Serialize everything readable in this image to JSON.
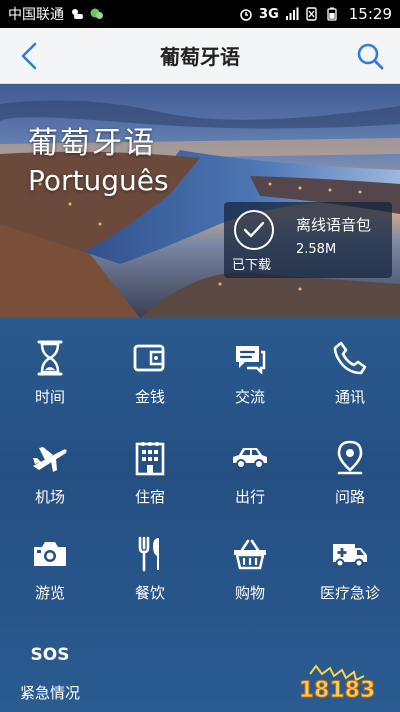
{
  "status_bar": {
    "carrier": "中国联通",
    "network": "3G",
    "time": "15:29"
  },
  "nav": {
    "title": "葡萄牙语"
  },
  "hero": {
    "title": "葡萄牙语",
    "subtitle": "Português",
    "download_status": "已下载",
    "pack_name": "离线语音包",
    "pack_size": "2.58M"
  },
  "categories": [
    {
      "label": "时间",
      "icon": "hourglass-icon"
    },
    {
      "label": "金钱",
      "icon": "wallet-icon"
    },
    {
      "label": "交流",
      "icon": "chat-icon"
    },
    {
      "label": "通讯",
      "icon": "phone-icon"
    },
    {
      "label": "机场",
      "icon": "airplane-icon"
    },
    {
      "label": "住宿",
      "icon": "hotel-icon"
    },
    {
      "label": "出行",
      "icon": "car-icon"
    },
    {
      "label": "问路",
      "icon": "location-pin-icon"
    },
    {
      "label": "游览",
      "icon": "camera-icon"
    },
    {
      "label": "餐饮",
      "icon": "fork-knife-icon"
    },
    {
      "label": "购物",
      "icon": "shopping-basket-icon"
    },
    {
      "label": "医疗急诊",
      "icon": "ambulance-icon"
    },
    {
      "label": "紧急情况",
      "icon": "sos-icon"
    }
  ],
  "watermark": {
    "text": "18183"
  },
  "colors": {
    "nav_accent": "#2f7fd6",
    "panel_bg": "#254f83"
  }
}
